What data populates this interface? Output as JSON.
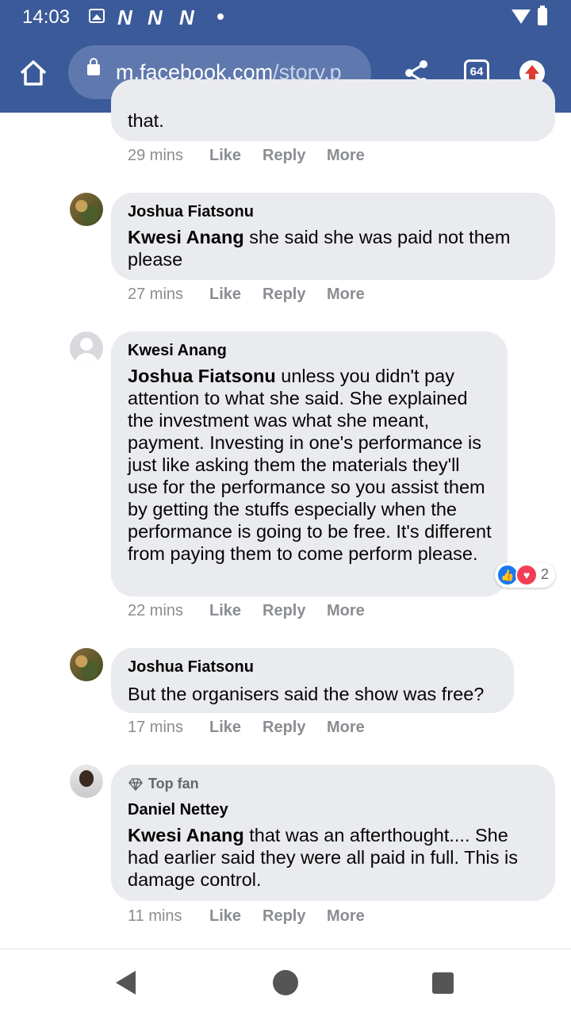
{
  "status_bar": {
    "time": "14:03",
    "notifications": [
      "N",
      "N",
      "N"
    ]
  },
  "browser": {
    "url_domain": "m.facebook.com",
    "url_path": "/story.p",
    "tab_count": "64"
  },
  "comments": [
    {
      "text": "that.",
      "time": "29 mins"
    },
    {
      "author": "Joshua Fiatsonu",
      "mention": "Kwesi Anang",
      "text": " she said she was paid not them please",
      "time": "27 mins"
    },
    {
      "author": "Kwesi Anang",
      "mention": "Joshua Fiatsonu",
      "text": " unless you didn't pay attention to what she said. She explained the investment was what she meant, payment. Investing in one's performance is just like asking them the materials they'll use for the performance so you assist them by getting the stuffs especially when the performance is going to be free. It's different from paying them to come perform please.",
      "time": "22 mins",
      "reaction_count": "2"
    },
    {
      "author": "Joshua Fiatsonu",
      "text": "But the organisers said the show was free?",
      "time": "17 mins"
    },
    {
      "badge": "Top fan",
      "author": "Daniel Nettey",
      "mention": "Kwesi Anang",
      "text": " that was an afterthought.... She had earlier said they were all paid in full. This is damage control.",
      "time": "11 mins"
    }
  ],
  "actions": {
    "like": "Like",
    "reply": "Reply",
    "more": "More"
  },
  "icons": [
    "home-icon",
    "lock-icon",
    "share-icon",
    "tabs-icon",
    "update-icon",
    "like-reaction-icon",
    "love-reaction-icon",
    "diamond-icon",
    "back-icon",
    "home-nav-icon",
    "recents-icon"
  ],
  "colors": {
    "header": "#3b5a9a",
    "bubble": "#eaebee",
    "meta": "#8a8d91",
    "like": "#1877f2",
    "love": "#f33e58"
  }
}
